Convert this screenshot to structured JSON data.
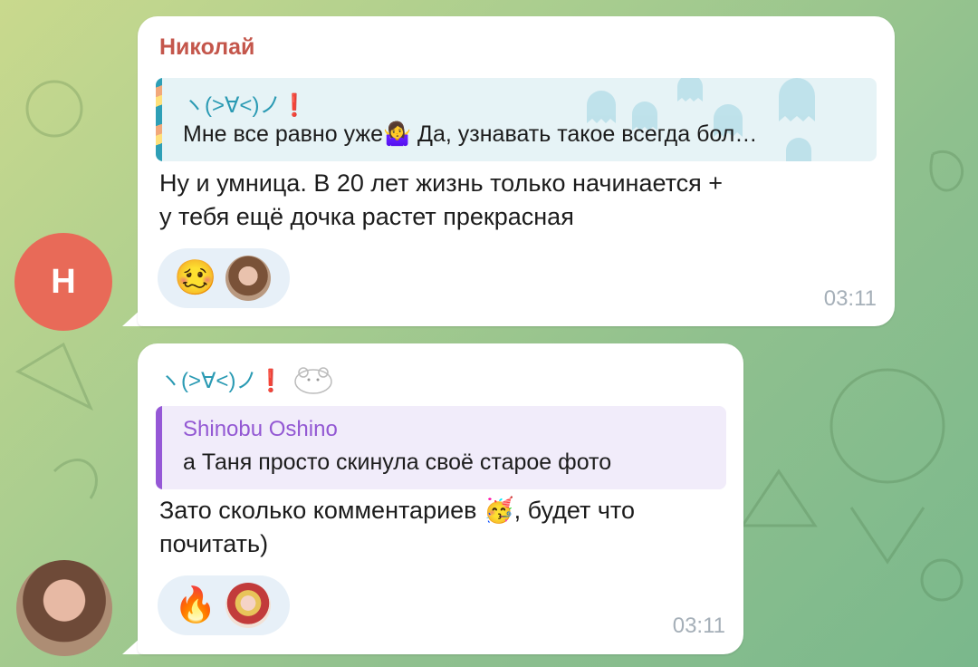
{
  "messages": [
    {
      "sender": "Николай",
      "avatar_letter": "Н",
      "reply": {
        "name": "ヽ(>∀<)ノ❗",
        "text": "Мне все равно уже🤷‍♀️ Да, узнавать такое всегда бол…"
      },
      "text_line1": "Ну и умница. В 20 лет жизнь только начинается +",
      "text_line2": "у тебя ещё дочка растет прекрасная",
      "reactions": {
        "emoji": "🥴",
        "reactor": "reactor-avatar"
      },
      "time": "03:11"
    },
    {
      "sender_kaomoji": "ヽ(>∀<)ノ❗",
      "reply": {
        "name": "Shinobu Oshino",
        "text": "а Таня просто скинула своё старое фото"
      },
      "text_line1": "Зато сколько комментариев 🥳, будет что",
      "text_line2": "почитать)",
      "reactions": {
        "emoji": "🔥",
        "reactor": "reactor-avatar"
      },
      "time": "03:11"
    }
  ],
  "colors": {
    "sender_name": "#c4564b",
    "reply_name_blue": "#2a9ab3",
    "reply_name_purple": "#9358d3",
    "avatar_bg": "#e86a58",
    "time": "#a5afb8"
  }
}
